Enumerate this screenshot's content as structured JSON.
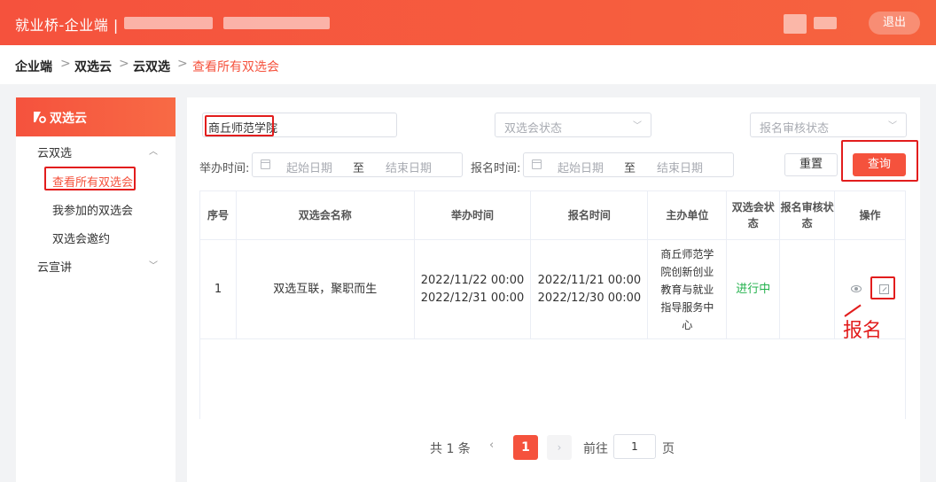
{
  "header": {
    "title": "就业桥-企业端 |",
    "logout_label": "退出"
  },
  "breadcrumb": {
    "items": [
      "企业端",
      "双选云",
      "云双选",
      "查看所有双选会"
    ],
    "separator": ">"
  },
  "sidebar": {
    "section_title": "双选云",
    "groups": [
      {
        "label": "云双选",
        "expanded": true,
        "children": [
          "查看所有双选会",
          "我参加的双选会",
          "双选会邀约"
        ]
      },
      {
        "label": "云宣讲",
        "expanded": false,
        "children": []
      }
    ]
  },
  "filters": {
    "school_value": "商丘师范学院",
    "fair_status_placeholder": "双选会状态",
    "review_status_placeholder": "报名审核状态",
    "hold_time_label": "举办时间:",
    "signup_time_label": "报名时间:",
    "start_placeholder": "起始日期",
    "end_placeholder": "结束日期",
    "to_label": "至",
    "reset_label": "重置",
    "query_label": "查询"
  },
  "table": {
    "headers": [
      "序号",
      "双选会名称",
      "举办时间",
      "报名时间",
      "主办单位",
      "双选会状态",
      "报名审核状态",
      "操作"
    ],
    "rows": [
      {
        "index": "1",
        "name": "双选互联，聚职而生",
        "hold_start": "2022/11/22 00:00",
        "hold_end": "2022/12/31 00:00",
        "signup_start": "2022/11/21 00:00",
        "signup_end": "2022/12/30 00:00",
        "organizer": "商丘师范学院创新创业教育与就业指导服务中心",
        "status": "进行中",
        "review_status": ""
      }
    ]
  },
  "pagination": {
    "total_text": "共 1 条",
    "current_page": "1",
    "goto_label": "前往",
    "goto_value": "1",
    "page_suffix": "页"
  },
  "annotation": {
    "label": "报名"
  },
  "colors": {
    "brand": "#f5523d",
    "highlight": "#e21d1d",
    "status_green": "#22b14c"
  }
}
